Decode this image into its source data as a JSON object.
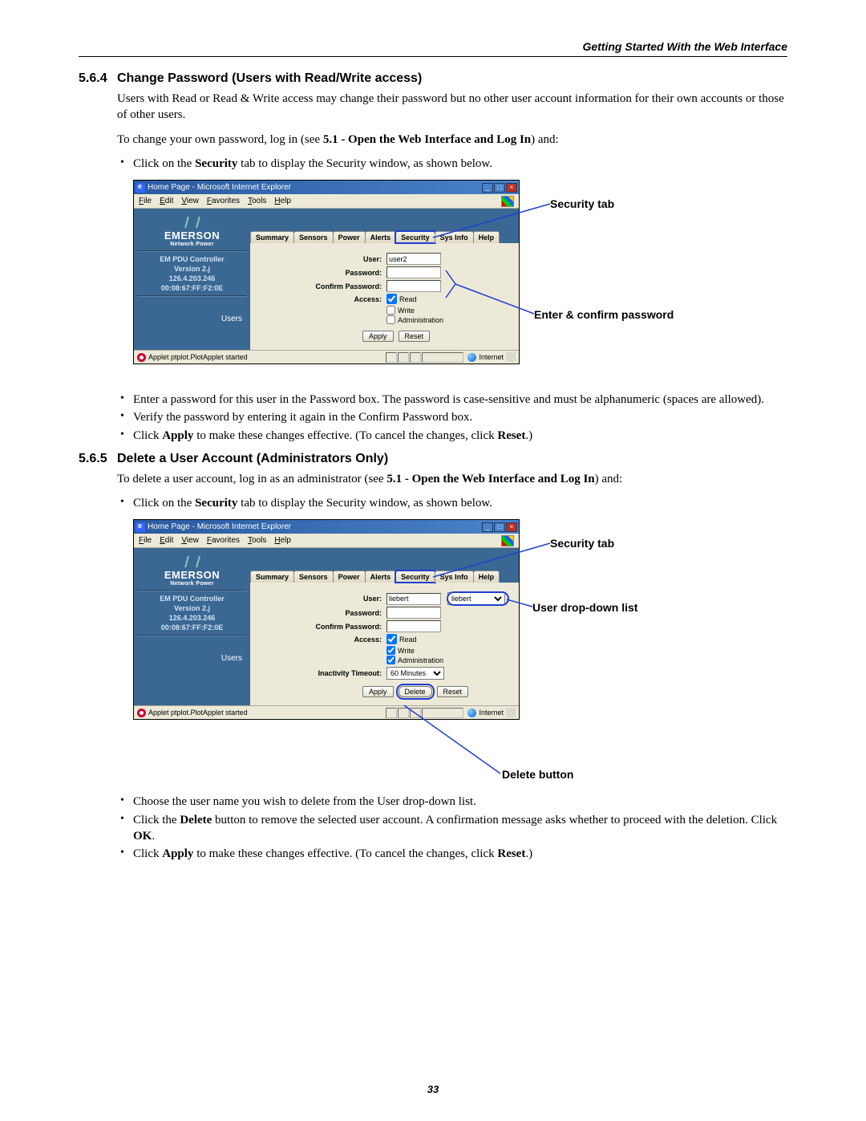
{
  "header": {
    "running_title": "Getting Started With the Web Interface"
  },
  "sec1": {
    "num": "5.6.4",
    "title": "Change Password (Users with Read/Write access)",
    "para1": "Users with Read or Read & Write access may change their password but no other user account information for their own accounts or those of other users.",
    "para2_a": "To change your own password, log in (see ",
    "para2_b": "5.1 - Open the Web Interface and Log In",
    "para2_c": ") and:",
    "bullet1_a": "Click on the ",
    "bullet1_b": "Security",
    "bullet1_c": " tab to display the Security window, as shown below.",
    "bullet2": "Enter a password for this user in the Password box. The password is case-sensitive and must be alphanumeric (spaces are allowed).",
    "bullet3": "Verify the password by entering it again in the Confirm Password box.",
    "bullet4_a": "Click ",
    "bullet4_b": "Apply",
    "bullet4_c": " to make these changes effective. (To cancel the changes, click ",
    "bullet4_d": "Reset",
    "bullet4_e": ".)"
  },
  "sec2": {
    "num": "5.6.5",
    "title": "Delete a User Account (Administrators Only)",
    "para1_a": "To delete a user account, log in as an administrator (see ",
    "para1_b": "5.1 - Open the Web Interface and Log In",
    "para1_c": ") and:",
    "bullet1_a": "Click on the ",
    "bullet1_b": "Security",
    "bullet1_c": " tab to display the Security window, as shown below.",
    "bullet2": "Choose the user name you wish to delete from the User drop-down list.",
    "bullet3_a": "Click the ",
    "bullet3_b": "Delete",
    "bullet3_c": " button to remove the selected user account. A confirmation message asks whether to proceed with the deletion. Click ",
    "bullet3_d": "OK",
    "bullet3_e": ".",
    "bullet4_a": "Click ",
    "bullet4_b": "Apply",
    "bullet4_c": " to make these changes effective. (To cancel the changes, click ",
    "bullet4_d": "Reset",
    "bullet4_e": ".)"
  },
  "ie": {
    "title": "Home Page - Microsoft Internet Explorer",
    "menu": {
      "file": "File",
      "edit": "Edit",
      "view": "View",
      "favorites": "Favorites",
      "tools": "Tools",
      "help": "Help"
    },
    "logo": {
      "name": "EMERSON",
      "sub": "Network Power"
    },
    "side": {
      "l1": "EM PDU Controller",
      "l2": "Version 2.j",
      "l3": "126.4.203.246",
      "l4": "00:08:67:FF:F2:0E",
      "users": "Users"
    },
    "tabs": {
      "summary": "Summary",
      "sensors": "Sensors",
      "power": "Power",
      "alerts": "Alerts",
      "security": "Security",
      "sysinfo": "Sys Info",
      "help": "Help"
    },
    "labels": {
      "user": "User:",
      "password": "Password:",
      "confirm": "Confirm Password:",
      "access": "Access:",
      "inactivity": "Inactivity Timeout:"
    },
    "checks": {
      "read": "Read",
      "write": "Write",
      "admin": "Administration"
    },
    "buttons": {
      "apply": "Apply",
      "delete": "Delete",
      "reset": "Reset"
    },
    "status": {
      "applet": "Applet ptplot.PlotApplet started",
      "zone": "Internet"
    },
    "fig1": {
      "user_value": "user2"
    },
    "fig2": {
      "user_value": "liebert",
      "dropdown_value": "liebert",
      "timeout": "60 Minutes"
    }
  },
  "callouts": {
    "security_tab": "Security tab",
    "enter_confirm": "Enter & confirm password",
    "user_dropdown": "User drop-down list",
    "delete_button": "Delete button"
  },
  "page_number": "33"
}
